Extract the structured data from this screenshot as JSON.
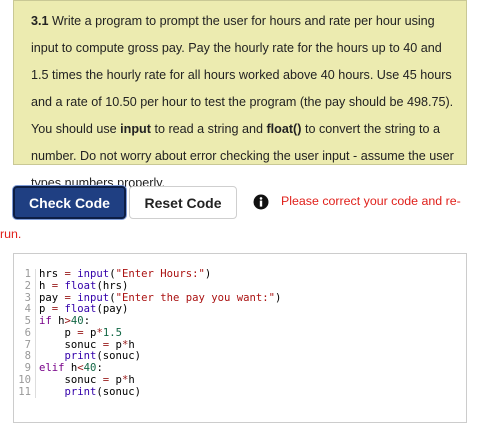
{
  "prompt": {
    "number": "3.1",
    "text_before_input": " Write a program to prompt the user for hours and rate per hour using input to compute gross pay. Pay the hourly rate for the hours up to 40 and 1.5 times the hourly rate for all hours worked above 40 hours. Use 45 hours and a rate of 10.50 per hour to test the program (the pay should be 498.75). You should use ",
    "input_word": "input",
    "text_between": " to read a string and ",
    "float_word": "float()",
    "text_after": " to convert the string to a number. Do not worry about error checking the user input - assume the user types numbers properly."
  },
  "buttons": {
    "check_code": "Check Code",
    "reset_code": "Reset Code"
  },
  "feedback": {
    "line1": "Please correct your code and re-",
    "line2": "run."
  },
  "colors": {
    "prompt_bg": "#ecebb0",
    "check_button_bg": "#1f3f82",
    "error_text": "#e0201b"
  },
  "icons": {
    "info": "info-circle-icon"
  },
  "code_lines": [
    {
      "n": "1",
      "text": "hrs = input(\"Enter Hours:\")"
    },
    {
      "n": "2",
      "text": "h = float(hrs)"
    },
    {
      "n": "3",
      "text": "pay = input(\"Enter the pay you want:\")"
    },
    {
      "n": "4",
      "text": "p = float(pay)"
    },
    {
      "n": "5",
      "text": "if h>40:"
    },
    {
      "n": "6",
      "text": "    p = p*1.5"
    },
    {
      "n": "7",
      "text": "    sonuc = p*h"
    },
    {
      "n": "8",
      "text": "    print(sonuc)"
    },
    {
      "n": "9",
      "text": "elif h<40:"
    },
    {
      "n": "10",
      "text": "    sonuc = p*h"
    },
    {
      "n": "11",
      "text": "    print(sonuc)"
    }
  ]
}
